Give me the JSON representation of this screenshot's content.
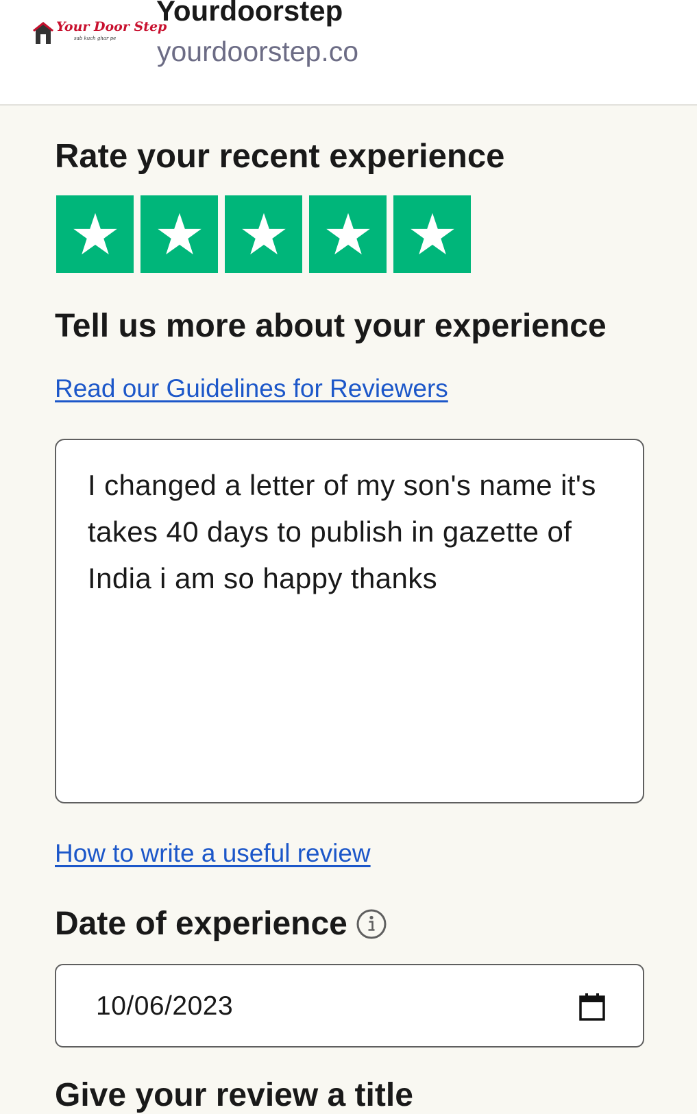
{
  "header": {
    "logo_text": "Your Door Step",
    "logo_tagline": "sab kuch ghar pe",
    "company_name": "Yourdoorstep",
    "company_domain": "yourdoorstep.co"
  },
  "rating": {
    "heading": "Rate your recent experience",
    "value": 5,
    "max": 5,
    "star_color": "#00b67a"
  },
  "experience": {
    "heading": "Tell us more about your experience",
    "guidelines_link": "Read our Guidelines for Reviewers",
    "review_text": "I changed a letter of my son's name it's takes 40 days to publish in gazette of India i am so happy thanks",
    "useful_review_link": "How to write a useful review"
  },
  "date_of_experience": {
    "heading": "Date of experience",
    "value": "10/06/2023"
  },
  "review_title": {
    "heading": "Give your review a title"
  },
  "colors": {
    "link": "#1c57c9",
    "background": "#f9f8f2"
  }
}
